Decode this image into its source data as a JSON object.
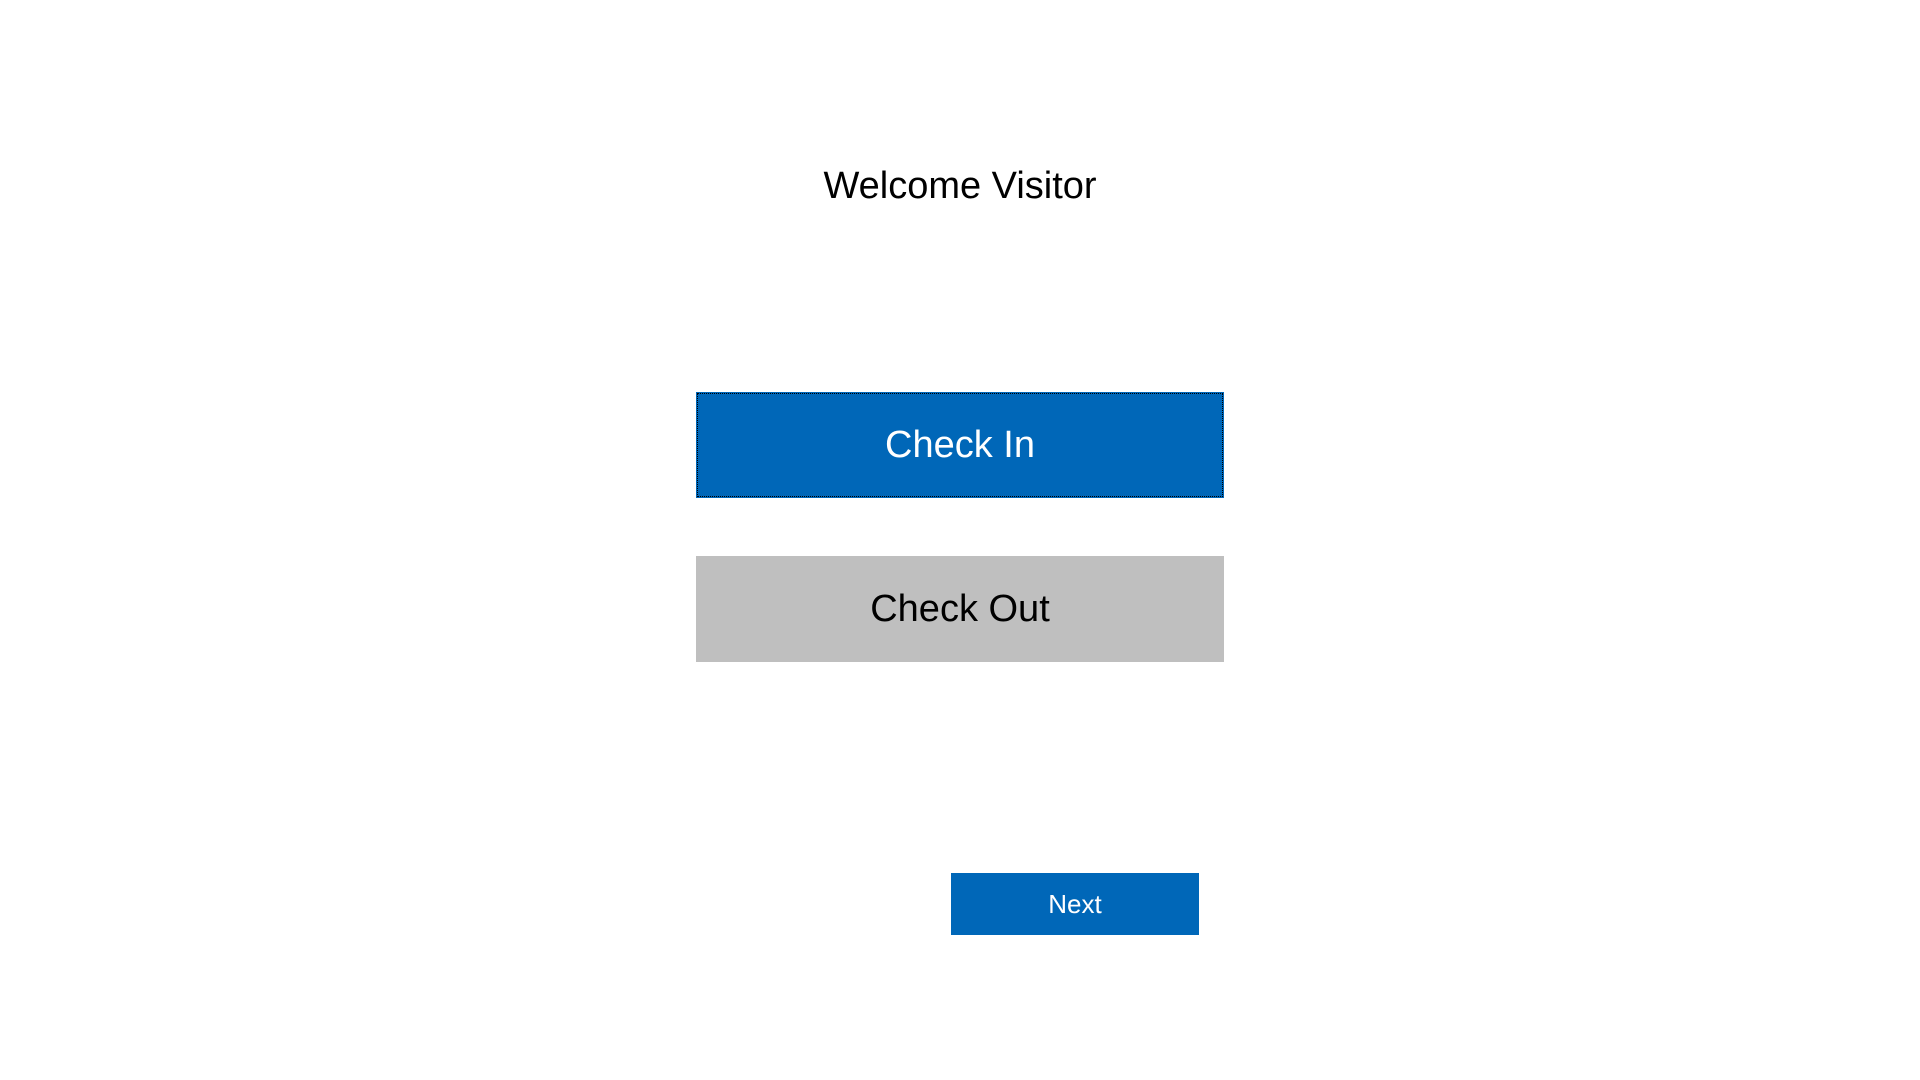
{
  "title": "Welcome Visitor",
  "buttons": {
    "check_in": "Check In",
    "check_out": "Check Out",
    "next": "Next"
  }
}
